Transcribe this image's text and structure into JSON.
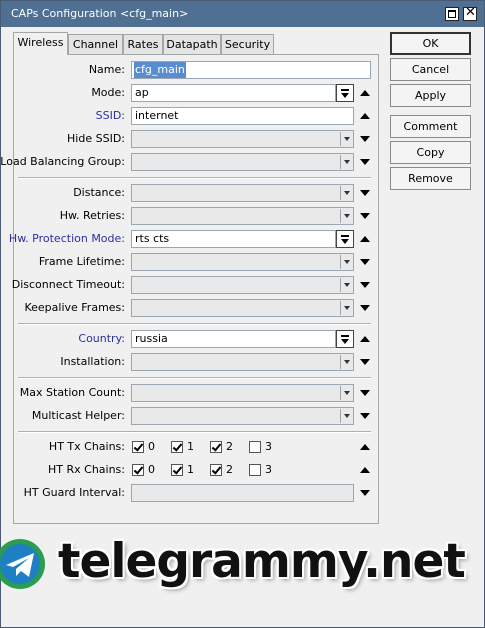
{
  "window": {
    "title": "CAPs Configuration <cfg_main>"
  },
  "tabs": [
    "Wireless",
    "Channel",
    "Rates",
    "Datapath",
    "Security"
  ],
  "fields": {
    "name": {
      "label": "Name:",
      "value": "cfg_main"
    },
    "mode": {
      "label": "Mode:",
      "value": "ap"
    },
    "ssid": {
      "label": "SSID:",
      "value": "internet"
    },
    "hide_ssid": {
      "label": "Hide SSID:",
      "value": ""
    },
    "load_balancing_group": {
      "label": "Load Balancing Group:",
      "value": ""
    },
    "distance": {
      "label": "Distance:",
      "value": ""
    },
    "hw_retries": {
      "label": "Hw. Retries:",
      "value": ""
    },
    "hw_protection_mode": {
      "label": "Hw. Protection Mode:",
      "value": "rts cts"
    },
    "frame_lifetime": {
      "label": "Frame Lifetime:",
      "value": ""
    },
    "disconnect_timeout": {
      "label": "Disconnect Timeout:",
      "value": ""
    },
    "keepalive_frames": {
      "label": "Keepalive Frames:",
      "value": ""
    },
    "country": {
      "label": "Country:",
      "value": "russia"
    },
    "installation": {
      "label": "Installation:",
      "value": ""
    },
    "max_station_count": {
      "label": "Max Station Count:",
      "value": ""
    },
    "multicast_helper": {
      "label": "Multicast Helper:",
      "value": ""
    },
    "ht_guard_interval": {
      "label": "HT Guard Interval:",
      "value": ""
    }
  },
  "ht_tx_chains": {
    "label": "HT Tx Chains:",
    "options": [
      {
        "label": "0",
        "checked": true
      },
      {
        "label": "1",
        "checked": true
      },
      {
        "label": "2",
        "checked": true
      },
      {
        "label": "3",
        "checked": false
      }
    ]
  },
  "ht_rx_chains": {
    "label": "HT Rx Chains:",
    "options": [
      {
        "label": "0",
        "checked": true
      },
      {
        "label": "1",
        "checked": true
      },
      {
        "label": "2",
        "checked": true
      },
      {
        "label": "3",
        "checked": false
      }
    ]
  },
  "buttons": {
    "ok": "OK",
    "cancel": "Cancel",
    "apply": "Apply",
    "comment": "Comment",
    "copy": "Copy",
    "remove": "Remove"
  },
  "watermark": {
    "text": "telegrammy.net"
  },
  "colors": {
    "titlebar": "#4f6f93",
    "highlight_label": "#2b2f9e",
    "selection": "#5a8dd0"
  }
}
